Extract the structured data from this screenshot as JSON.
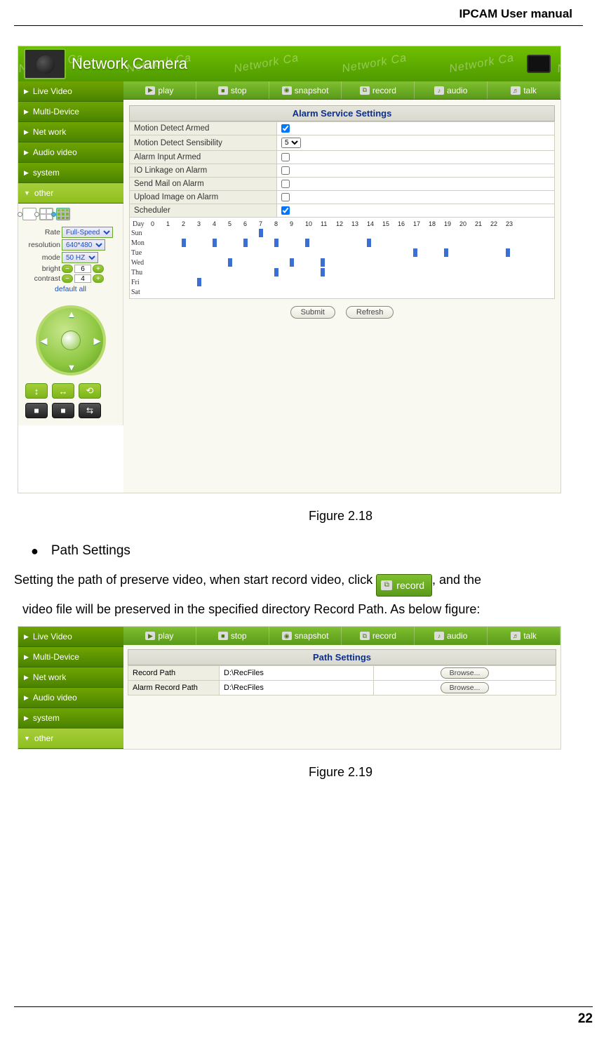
{
  "doc": {
    "header": "IPCAM User manual",
    "page_number": "22",
    "figure218_caption": "Figure 2.18",
    "figure219_caption": "Figure 2.19",
    "section_path_settings": "Path Settings",
    "path_text_1": "Setting the path of preserve video, when start record video, click",
    "path_text_2": ", and the",
    "path_text_3": "video file will be preserved in the specified directory Record Path. As below figure:"
  },
  "app": {
    "banner": {
      "title": "Network Camera",
      "watermark": "Network Ca"
    },
    "nav": {
      "items": [
        {
          "label": "Live Video",
          "open": false
        },
        {
          "label": "Multi-Device",
          "open": false
        },
        {
          "label": "Net work",
          "open": false
        },
        {
          "label": "Audio video",
          "open": false
        },
        {
          "label": "system",
          "open": false
        },
        {
          "label": "other",
          "open": true
        }
      ]
    },
    "toolbar": {
      "play": "play",
      "stop": "stop",
      "snapshot": "snapshot",
      "record": "record",
      "audio": "audio",
      "talk": "talk"
    },
    "controls": {
      "rate_label": "Rate",
      "rate_value": "Full-Speed",
      "resolution_label": "resolution",
      "resolution_value": "640*480",
      "mode_label": "mode",
      "mode_value": "50 HZ",
      "bright_label": "bright",
      "bright_value": "6",
      "contrast_label": "contrast",
      "contrast_value": "4",
      "default_all": "default all"
    },
    "alarm": {
      "title": "Alarm Service Settings",
      "rows": {
        "motion_detect_armed": {
          "label": "Motion Detect Armed",
          "checked": true
        },
        "motion_detect_sens": {
          "label": "Motion Detect Sensibility",
          "value": "5"
        },
        "alarm_input_armed": {
          "label": "Alarm Input Armed",
          "checked": false
        },
        "io_linkage": {
          "label": "IO Linkage on Alarm",
          "checked": false
        },
        "send_mail": {
          "label": "Send Mail on Alarm",
          "checked": false
        },
        "upload_image": {
          "label": "Upload Image on Alarm",
          "checked": false
        },
        "scheduler": {
          "label": "Scheduler",
          "checked": true
        }
      },
      "schedule": {
        "day_label": "Day",
        "hours": [
          "0",
          "1",
          "2",
          "3",
          "4",
          "5",
          "6",
          "7",
          "8",
          "9",
          "10",
          "11",
          "12",
          "13",
          "14",
          "15",
          "16",
          "17",
          "18",
          "19",
          "20",
          "21",
          "22",
          "23"
        ],
        "days": [
          "Sun",
          "Mon",
          "Tue",
          "Wed",
          "Thu",
          "Fri",
          "Sat"
        ],
        "marks": {
          "Sun": [
            7
          ],
          "Mon": [
            2,
            4,
            6,
            8,
            10,
            14
          ],
          "Tue": [
            17,
            19,
            23
          ],
          "Wed": [
            5,
            9,
            11
          ],
          "Thu": [
            8,
            11
          ],
          "Fri": [
            3
          ],
          "Sat": []
        }
      },
      "submit": "Submit",
      "refresh": "Refresh"
    }
  },
  "path": {
    "title": "Path Settings",
    "record_path_label": "Record Path",
    "record_path_value": "D:\\RecFiles",
    "alarm_record_path_label": "Alarm Record Path",
    "alarm_record_path_value": "D:\\RecFiles",
    "browse": "Browse..."
  }
}
